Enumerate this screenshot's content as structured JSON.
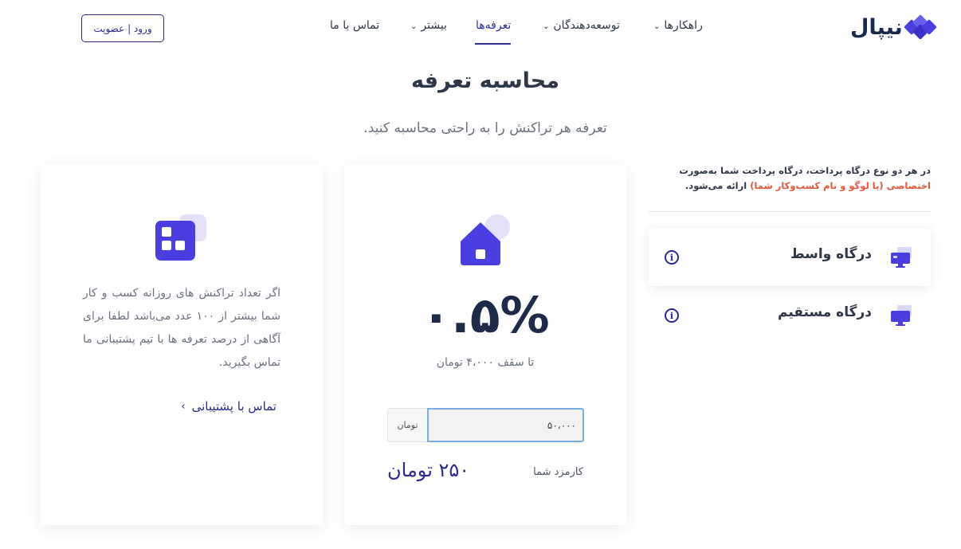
{
  "header": {
    "logo_text": "نیپال",
    "nav": [
      {
        "label": "راهکارها",
        "has_dropdown": true
      },
      {
        "label": "توسعه‌دهندگان",
        "has_dropdown": true
      },
      {
        "label": "تعرفه‌ها",
        "active": true
      },
      {
        "label": "بیشتر",
        "has_dropdown": true
      },
      {
        "label": "تماس با ما"
      }
    ],
    "login_label": "ورود | عضویت"
  },
  "page": {
    "title": "محاسبه تعرفه",
    "subtitle": "تعرفه هر تراکنش را به راحتی محاسبه کنید."
  },
  "gateways": {
    "note_part1": "در هر دو نوع درگاه پرداخت، درگاه پرداخت شما به‌صورت ",
    "note_accent": "اختصاصی (با لوگو و نام کسب‌وکار شما)",
    "note_part2": " ارائه می‌شود.",
    "items": [
      {
        "label": "درگاه واسط",
        "active": true
      },
      {
        "label": "درگاه مستقیم",
        "active": false
      }
    ]
  },
  "calculator": {
    "rate": "۰.۵%",
    "cap": "تا سقف ۴،۰۰۰ تومان",
    "amount_value": "۵۰،۰۰۰",
    "amount_unit": "تومان",
    "fee_label": "کارمزد شما",
    "fee_value": "۲۵۰ تومان"
  },
  "enterprise": {
    "text": "اگر تعداد تراکنش های روزانه کسب و کار شما بیشتر از ۱۰۰ عدد می‌باشد لطفا برای آگاهی از درصد تعرفه ها با تیم پشتیبانی ما تماس بگیرید.",
    "link_label": "تماس با پشتیبانی"
  },
  "colors": {
    "brand": "#2b2b8f",
    "accent_purple": "#4a3ee0",
    "accent_orange": "#e8553a",
    "text_dark": "#2d3748"
  }
}
